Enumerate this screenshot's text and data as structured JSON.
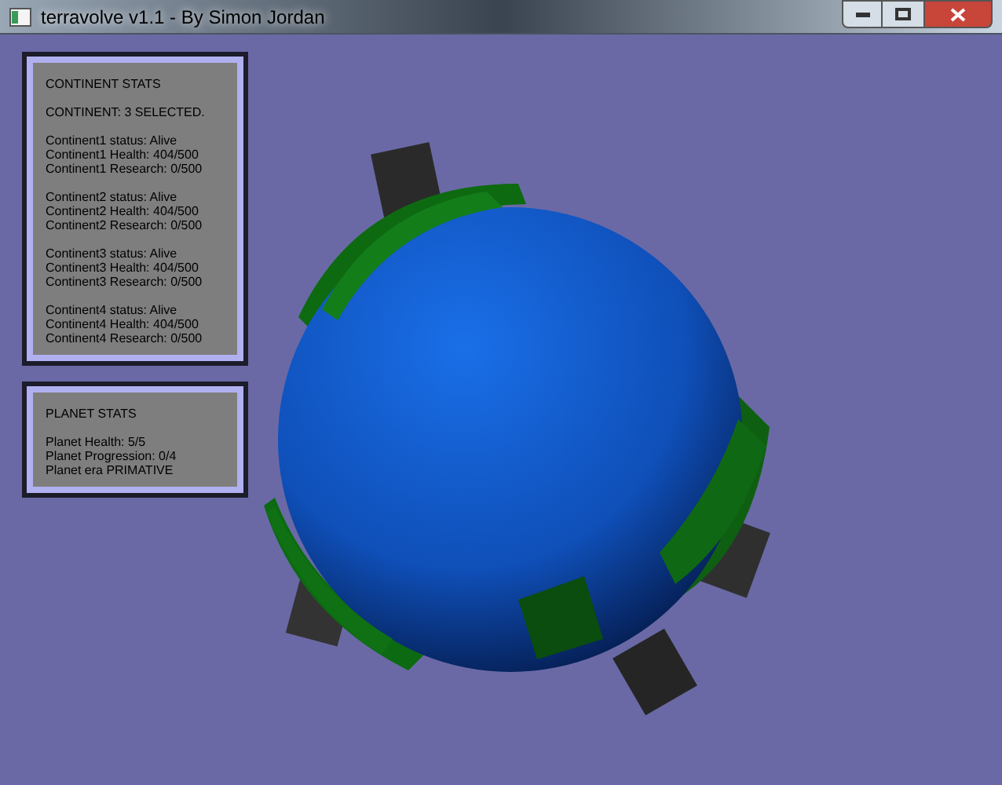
{
  "window": {
    "title": "terravolve v1.1 - By Simon Jordan"
  },
  "panels": [
    {
      "heading": "CONTINENT STATS",
      "sections": [
        [
          "CONTINENT: 3 SELECTED."
        ],
        [
          "Continent1 status: Alive",
          "Continent1 Health: 404/500",
          "Continent1 Research: 0/500"
        ],
        [
          "Continent2 status: Alive",
          "Continent2 Health: 404/500",
          "Continent2 Research: 0/500"
        ],
        [
          "Continent3 status: Alive",
          "Continent3 Health: 404/500",
          "Continent3 Research: 0/500"
        ],
        [
          "Continent4 status: Alive",
          "Continent4 Health: 404/500",
          "Continent4 Research: 0/500"
        ]
      ]
    },
    {
      "heading": "PLANET STATS",
      "sections": [
        [
          "Planet Health: 5/5",
          "Planet Progression: 0/4",
          "Planet era PRIMATIVE"
        ]
      ]
    }
  ]
}
